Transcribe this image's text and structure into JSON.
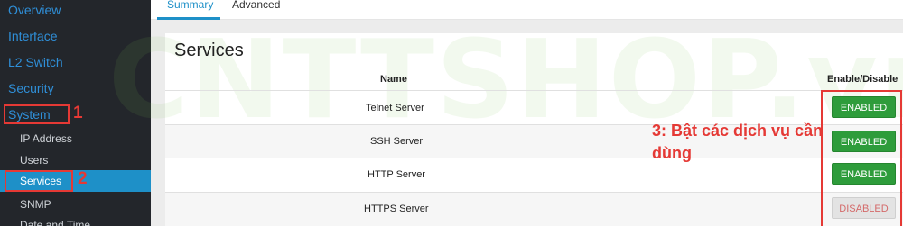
{
  "sidebar": {
    "items": [
      {
        "label": "Overview"
      },
      {
        "label": "Interface"
      },
      {
        "label": "L2 Switch"
      },
      {
        "label": "Security"
      },
      {
        "label": "System"
      }
    ],
    "sub_items": [
      {
        "label": "IP Address"
      },
      {
        "label": "Users"
      },
      {
        "label": "Services"
      },
      {
        "label": "SNMP"
      },
      {
        "label": "Date and Time"
      }
    ]
  },
  "tabs": [
    {
      "label": "Summary"
    },
    {
      "label": "Advanced"
    }
  ],
  "panel": {
    "title": "Services"
  },
  "table": {
    "headers": {
      "name": "Name",
      "enable": "Enable/Disable"
    },
    "rows": [
      {
        "name": "Telnet Server",
        "status": "ENABLED"
      },
      {
        "name": "SSH Server",
        "status": "ENABLED"
      },
      {
        "name": "HTTP Server",
        "status": "ENABLED"
      },
      {
        "name": "HTTPS Server",
        "status": "DISABLED"
      }
    ]
  },
  "annotations": {
    "num1": "1",
    "num2": "2",
    "note": "3: Bật các dịch vụ cần dùng"
  },
  "colors": {
    "accent": "#1e90c8",
    "enabled": "#2e9c3b",
    "annotation": "#e53935",
    "sidebar_bg": "#23262b"
  },
  "watermark": "CNTTSHOP.vn"
}
